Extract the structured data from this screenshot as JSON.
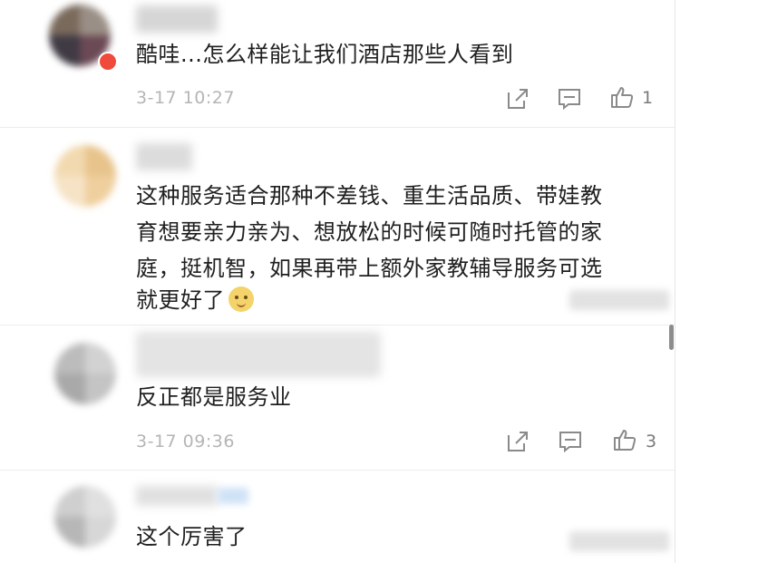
{
  "comments": [
    {
      "text": "酷哇...怎么样能让我们酒店那些人看到",
      "time": "3-17 10:27",
      "likes": "1"
    },
    {
      "text_lines": [
        "这种服务适合那种不差钱、重生活品质、带娃教",
        "育想要亲力亲为、想放松的时候可随时托管的家",
        "庭，挺机智，如果再带上额外家教辅导服务可选",
        "就更好了"
      ],
      "emoji_icon": "doge-emoji-icon"
    },
    {
      "text": "反正都是服务业",
      "time": "3-17 09:36",
      "likes": "3"
    },
    {
      "text": "这个厉害了"
    }
  ],
  "icons": {
    "share": "share-icon",
    "reply": "reply-icon",
    "like": "thumbs-up-icon"
  },
  "colors": {
    "meta_text": "#b5b5b5",
    "comment_text": "#1f1f1f",
    "badge": "#ef4a3c"
  }
}
